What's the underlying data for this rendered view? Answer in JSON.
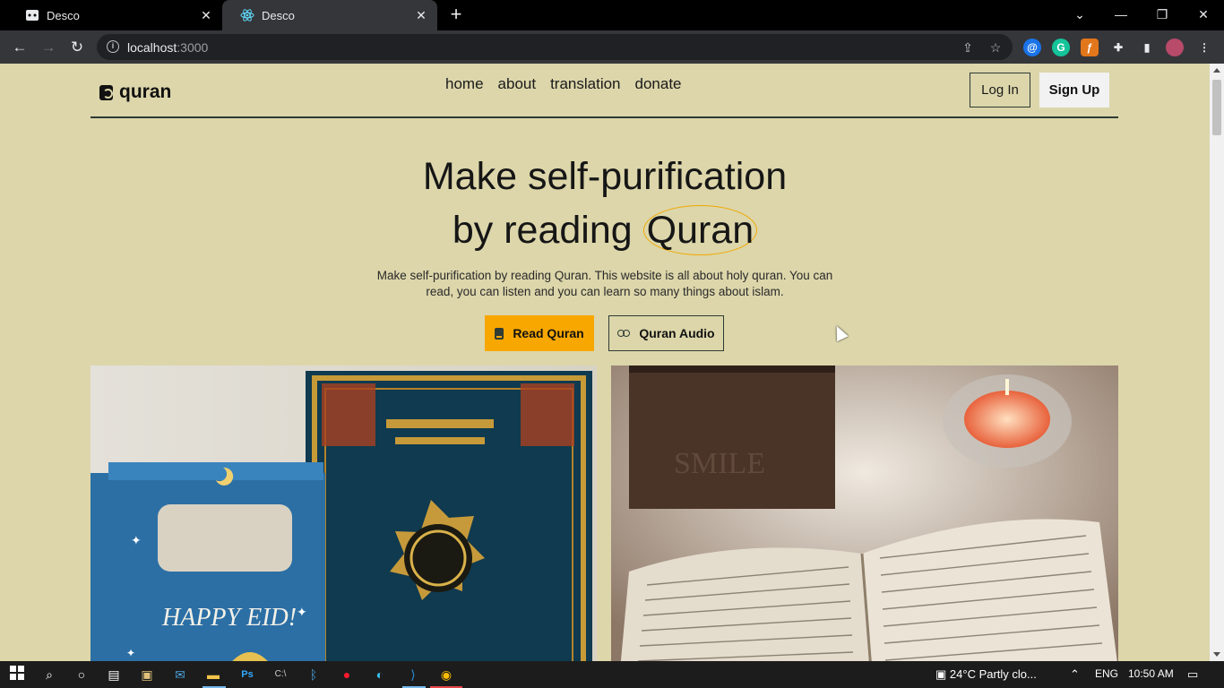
{
  "browser": {
    "tabs": [
      {
        "title": "Desco",
        "active": false
      },
      {
        "title": "Desco",
        "active": true
      }
    ],
    "new_tab": "+",
    "url_host": "localhost",
    "url_port": ":3000",
    "window_controls": {
      "minimize": "—",
      "restore": "❐",
      "close": "✕"
    }
  },
  "site": {
    "logo_text": "quran",
    "menu": [
      "home",
      "about",
      "translation",
      "donate"
    ],
    "login_label": "Log In",
    "signup_label": "Sign Up",
    "hero_line1": "Make self-purification",
    "hero_line2_prefix": "by reading ",
    "hero_highlight": "Quran",
    "hero_sub": "Make self-purification by reading Quran. This website is all about holy quran. You can read, you can listen and you can learn so many things about islam.",
    "read_button": "Read Quran",
    "audio_button": "Quran Audio",
    "accent_color": "#f7a700",
    "background_color": "#dcd6aa"
  },
  "taskbar": {
    "weather": "24°C  Partly clo...",
    "language": "ENG",
    "time": "10:50 AM"
  }
}
